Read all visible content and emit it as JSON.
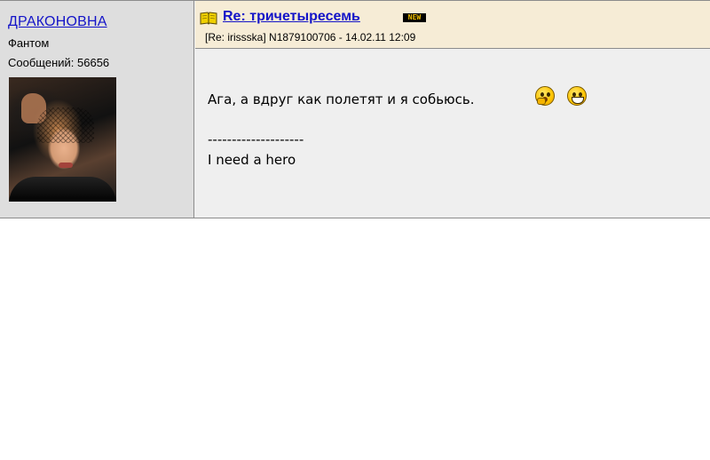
{
  "post": {
    "author": "ДРАКОНОВНА",
    "rank": "Фантом",
    "message_count": "Сообщений: 56656",
    "title": "Re: тричетыресемь",
    "new_badge": "NEW",
    "reply_to": "[Re: irissska]",
    "post_id_date": "N1879100706 - 14.02.11 12:09",
    "body": "Ага, а вдруг как полетят и я собьюсь.",
    "signature_divider": "--------------------",
    "signature": "I need a hero"
  },
  "icons": {
    "title_icon": "open-book-icon",
    "smiley_1": "thinking-smiley-icon",
    "smiley_2": "grinning-smiley-icon"
  },
  "colors": {
    "link": "#1414c8",
    "sidebar_bg": "#dedede",
    "header_bg": "#f6ecd6",
    "body_bg": "#efefef",
    "border": "#8c8c8c"
  }
}
